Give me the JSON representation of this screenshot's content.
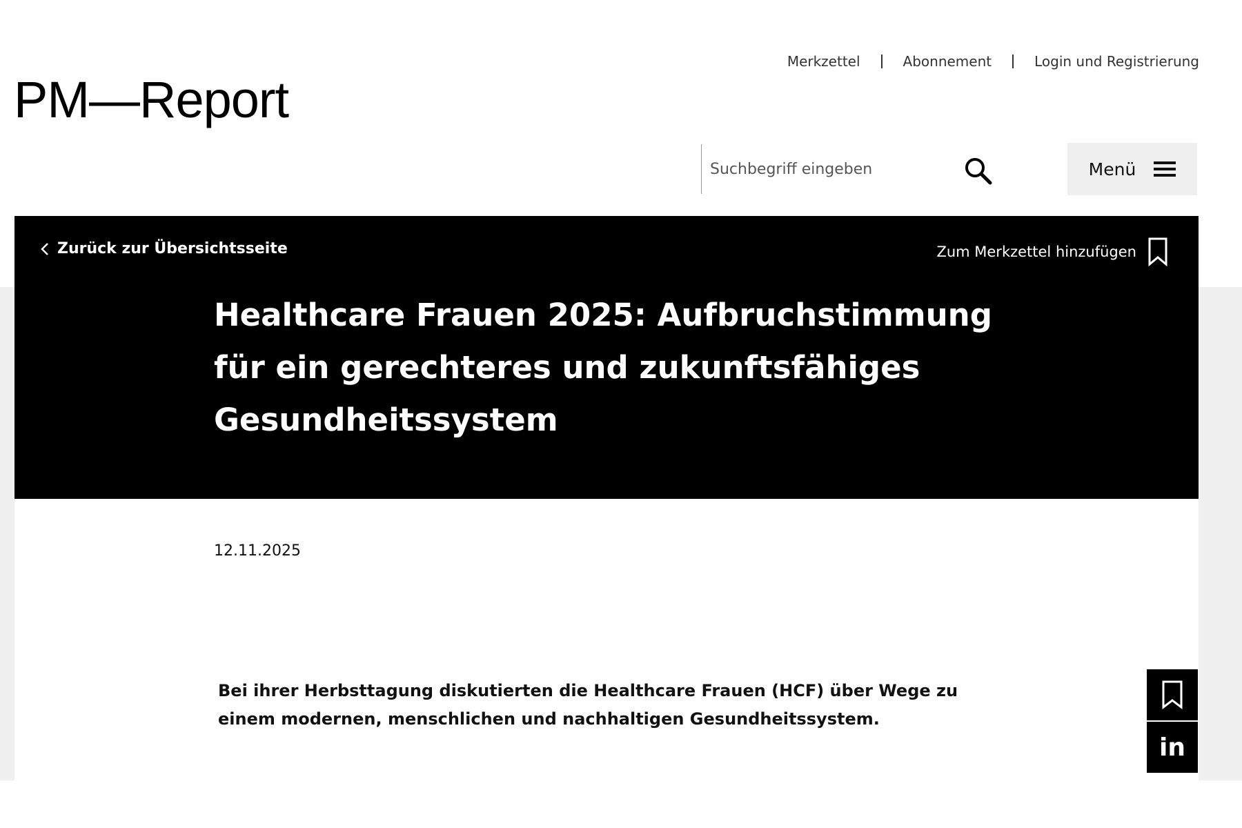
{
  "header": {
    "top_links": [
      "Merkzettel",
      "Abonnement",
      "Login und Registrierung"
    ],
    "logo_text": "PM—Report",
    "search_placeholder": "Suchbegriff eingeben",
    "menu_label": "Menü"
  },
  "hero": {
    "back_label": "Zurück zur Übersichtsseite",
    "bookmark_label": "Zum Merkzettel hinzufügen",
    "title": "Healthcare Frauen 2025: Aufbruchstimmung für ein gerechteres und zukunftsfähiges Gesundheitssystem"
  },
  "article": {
    "date": "12.11.2025",
    "lead": "Bei ihrer Herbsttagung diskutierten die Healthcare Frauen (HCF) über Wege zu einem modernen, menschlichen und nachhaltigen Gesundheitssystem."
  },
  "share": {
    "items": [
      "bookmark-icon",
      "linkedin-icon"
    ],
    "linkedin_glyph": "in"
  },
  "colors": {
    "hero_bg": "#000000",
    "page_bg": "#f0f0f0",
    "menu_bg": "#efefef"
  }
}
